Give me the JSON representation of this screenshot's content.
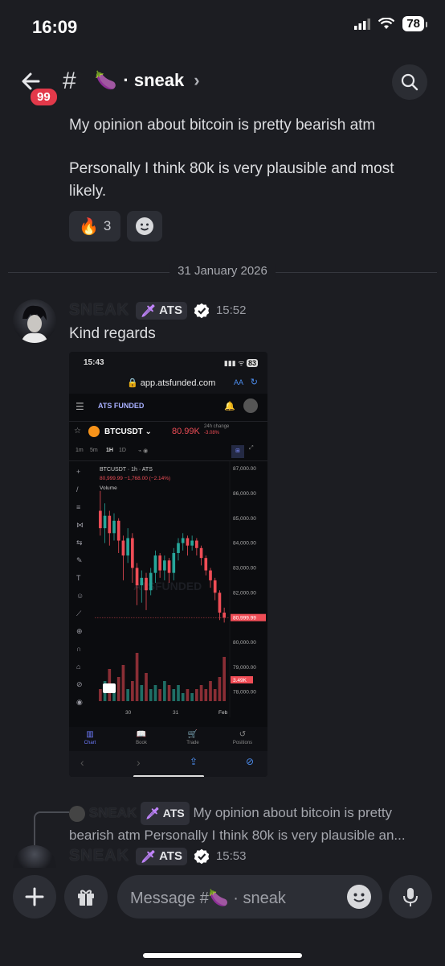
{
  "status": {
    "time": "16:09",
    "battery": "78"
  },
  "header": {
    "unread_badge": "99",
    "channel_emoji": "🍆",
    "channel_name": "· sneak"
  },
  "messages": [
    {
      "line1": "My opinion about bitcoin is pretty bearish atm",
      "line2": "Personally I think 80k is very plausible and most",
      "line3": "likely."
    }
  ],
  "reactions": [
    {
      "emoji": "🔥",
      "count": "3"
    }
  ],
  "date_divider": "31 January 2026",
  "post": {
    "author": "SNEAK",
    "tag": "ATS",
    "time": "15:52",
    "text": "Kind regards"
  },
  "screenshot": {
    "time": "15:43",
    "battery": "83",
    "url": "app.atsfunded.com",
    "aa": "AA",
    "brand": "ATS FUNDED",
    "pair": "BTCUSDT",
    "price": "80.99K",
    "change_label": "24h change",
    "change_value": "-3.08%",
    "timeframes": [
      "1m",
      "5m",
      "1H",
      "1D"
    ],
    "chart_title": "BTCUSDT · 1h · ATS",
    "chart_ohlc": "80,999.99 −1,768.00 (−2.14%)",
    "volume_label": "Volume",
    "watermark": "ATSFUNDED",
    "x_labels": [
      "30",
      "31",
      "Feb"
    ],
    "tabs": [
      "Chart",
      "Book",
      "Trade",
      "Positions"
    ]
  },
  "chart_data": {
    "type": "bar",
    "title": "BTCUSDT · 1h · ATS",
    "y_ticks": [
      "87,000.00",
      "86,000.00",
      "85,000.00",
      "84,000.00",
      "83,000.00",
      "82,000.00",
      "81,000.00",
      "80,000.00",
      "79,000.00",
      "78,000.00"
    ],
    "last_price_label": "80,999.99",
    "volume_tag": "3.49K",
    "ylim": [
      77700,
      87100
    ],
    "candles": [
      [
        85300,
        84600,
        86100,
        84300
      ],
      [
        84600,
        85100,
        85600,
        84000
      ],
      [
        85100,
        84400,
        85300,
        83900
      ],
      [
        84400,
        84900,
        85200,
        84100
      ],
      [
        84900,
        84100,
        85000,
        83600
      ],
      [
        84100,
        83500,
        84300,
        82500
      ],
      [
        83500,
        84200,
        84600,
        83200
      ],
      [
        84200,
        83000,
        84400,
        82400
      ],
      [
        83000,
        82300,
        83200,
        81500
      ],
      [
        82300,
        82600,
        82900,
        81600
      ],
      [
        82600,
        82100,
        82800,
        81300
      ],
      [
        82100,
        82800,
        83000,
        81900
      ],
      [
        82800,
        83500,
        83700,
        82400
      ],
      [
        83500,
        82900,
        83600,
        82600
      ],
      [
        82900,
        83300,
        83500,
        82500
      ],
      [
        83300,
        82800,
        83400,
        82400
      ],
      [
        82800,
        83600,
        83800,
        82500
      ],
      [
        83600,
        84000,
        84200,
        83300
      ],
      [
        84000,
        84200,
        84400,
        83700
      ],
      [
        84200,
        83900,
        84300,
        83500
      ],
      [
        83900,
        84100,
        84300,
        83700
      ],
      [
        84100,
        83800,
        84200,
        83500
      ],
      [
        83800,
        83400,
        83900,
        83100
      ],
      [
        83400,
        82900,
        83500,
        82700
      ],
      [
        82900,
        82500,
        83000,
        82200
      ],
      [
        82500,
        82000,
        82600,
        81700
      ],
      [
        82000,
        81200,
        82100,
        80900
      ],
      [
        81200,
        81000,
        81400,
        80800
      ]
    ],
    "volumes": [
      3,
      5,
      8,
      4,
      6,
      9,
      3,
      5,
      12,
      4,
      7,
      3,
      4,
      3,
      5,
      4,
      3,
      4,
      2,
      3,
      2,
      3,
      4,
      3,
      5,
      3,
      6,
      11
    ]
  },
  "reply": {
    "author": "SNEAK",
    "tag": "ATS",
    "line1": "My opinion about bitcoin is pretty",
    "line2": "bearish atm   Personally I think 80k is very plausible an..."
  },
  "post2": {
    "author": "SNEAK",
    "tag": "ATS",
    "time": "15:53"
  },
  "composer": {
    "placeholder": "Message #🍆 · sneak"
  }
}
